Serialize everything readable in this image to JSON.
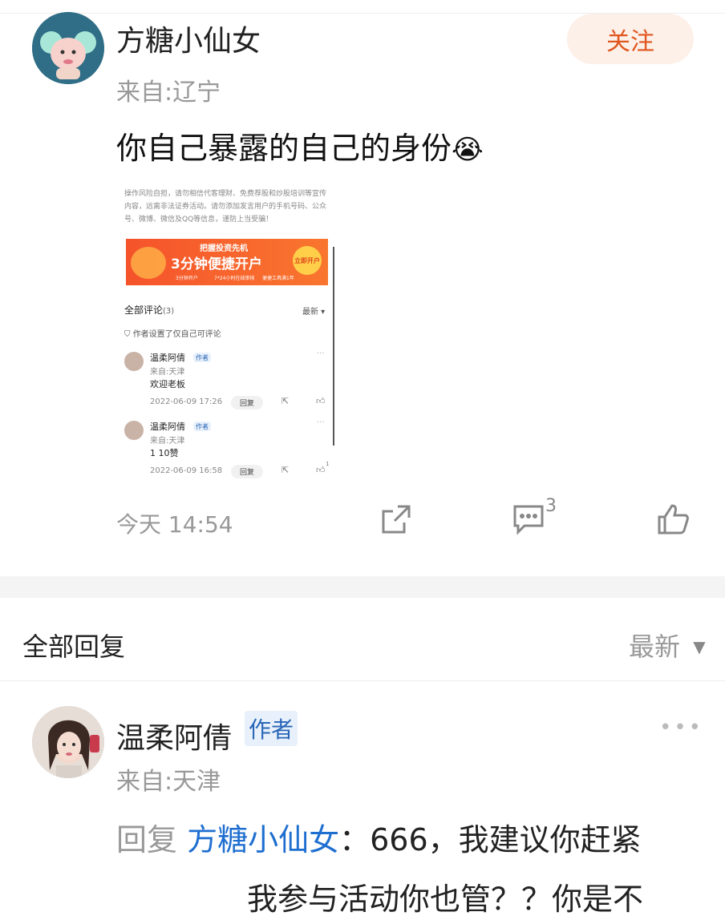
{
  "post": {
    "author": "方糖小仙女",
    "location": "来自:辽宁",
    "follow_label": "关注",
    "text": "你自己暴露的自己的身份",
    "emoji": "😭",
    "time": "今天 14:54",
    "comment_count": "3"
  },
  "embedded": {
    "notice": [
      "操作风险自担，请勿相信代客理财、免费荐股和炒股培训等宣传",
      "内容，远离非法证券活动。请勿添加发言用户的手机号码、公众",
      "号、微博、微信及QQ等信息，谨防上当受骗！"
    ],
    "banner_top": "把握投资先机",
    "banner_main": "3分钟便捷开户",
    "banner_btn": "立即开户",
    "banner_tags": [
      "3分钟开户",
      "7*24小时在线审核",
      "便捷工具满1年"
    ],
    "comments_title": "全部评论",
    "comments_count": "(3)",
    "sort": "最新 ▾",
    "restrict": "作者设置了仅自己可评论",
    "comments": [
      {
        "name": "温柔阿倩",
        "badge": "作者",
        "loc": "来自:天津",
        "text": "欢迎老板",
        "time": "2022-06-09 17:26",
        "reply": "回复"
      },
      {
        "name": "温柔阿倩",
        "badge": "作者",
        "loc": "来自:天津",
        "text": "1 10赞",
        "time": "2022-06-09 16:58",
        "reply": "回复",
        "like_count": "1"
      }
    ]
  },
  "replies_header": {
    "title": "全部回复",
    "sort": "最新"
  },
  "reply": {
    "author": "温柔阿倩",
    "badge": "作者",
    "location": "来自:天津",
    "prefix": "回复 ",
    "target": "方糖小仙女",
    "text_line1": "：666，我建议你赶紧",
    "text_line2": "我参与活动你也管？？你是不"
  },
  "colors": {
    "accent": "#e0561f",
    "link": "#1f6fd0",
    "banner": "#f5532b"
  },
  "icons": [
    "share-icon",
    "comment-icon",
    "like-icon",
    "more-icon",
    "filter-icon",
    "chevron-down-icon"
  ]
}
